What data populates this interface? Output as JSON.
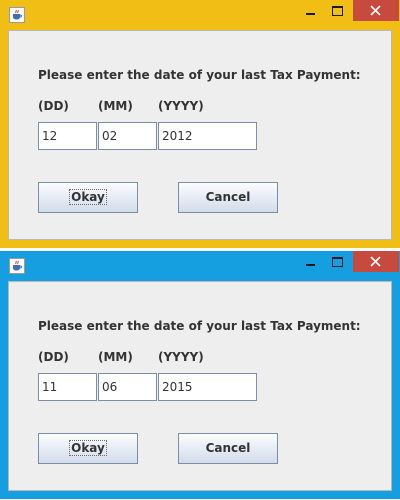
{
  "windows": [
    {
      "frame_color": "#f0be14",
      "prompt": "Please enter the date of your last Tax Payment:",
      "labels": {
        "dd": "(DD)",
        "mm": "(MM)",
        "yyyy": "(YYYY)"
      },
      "values": {
        "dd": "12",
        "mm": "02",
        "yyyy": "2012"
      },
      "buttons": {
        "okay": "Okay",
        "cancel": "Cancel"
      },
      "focused_button": "okay"
    },
    {
      "frame_color": "#169fe0",
      "prompt": "Please enter the date of your last Tax Payment:",
      "labels": {
        "dd": "(DD)",
        "mm": "(MM)",
        "yyyy": "(YYYY)"
      },
      "values": {
        "dd": "11",
        "mm": "06",
        "yyyy": "2015"
      },
      "buttons": {
        "okay": "Okay",
        "cancel": "Cancel"
      },
      "focused_button": "okay"
    }
  ],
  "icons": {
    "app": "java-cup-icon",
    "minimize": "minimize-icon",
    "maximize": "maximize-icon",
    "close": "close-icon"
  },
  "colors": {
    "close_button": "#c74a3e",
    "content_background": "#eeeeee",
    "text_field_border": "#7a8ea8"
  }
}
